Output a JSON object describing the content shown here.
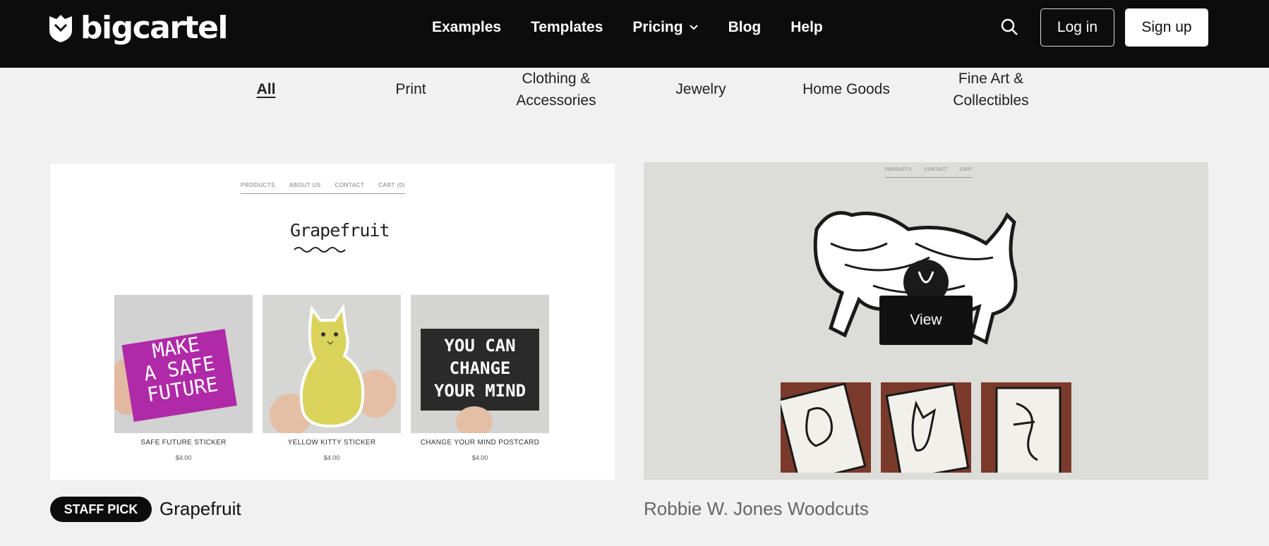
{
  "header": {
    "logo_text": "bigcartel",
    "nav": [
      "Examples",
      "Templates",
      "Pricing",
      "Blog",
      "Help"
    ],
    "login_label": "Log in",
    "signup_label": "Sign up"
  },
  "categories": {
    "all": "All",
    "print": "Print",
    "clothing_line1": "Clothing &",
    "clothing_line2": "Accessories",
    "jewelry": "Jewelry",
    "home_goods": "Home Goods",
    "fineart_line1": "Fine Art &",
    "fineart_line2": "Collectibles"
  },
  "grapefruit_card": {
    "shop_nav": [
      "PRODUCTS",
      "ABOUT US",
      "CONTACT",
      "CART (0)"
    ],
    "shop_logo": "Grapefruit",
    "products": [
      {
        "name": "SAFE FUTURE STICKER",
        "price": "$4.00",
        "art_line1": "MAKE",
        "art_line2": "A SAFE",
        "art_line3": "FUTURE"
      },
      {
        "name": "YELLOW KITTY STICKER",
        "price": "$4.00"
      },
      {
        "name": "CHANGE YOUR MIND POSTCARD",
        "price": "$4.00",
        "art_line1": "YOU CAN",
        "art_line2": "CHANGE",
        "art_line3": "YOUR MIND"
      }
    ],
    "badge": "STAFF PICK",
    "caption": "Grapefruit"
  },
  "robbie_card": {
    "shop_nav": [
      "PRODUCTS",
      "CONTACT",
      "CART"
    ],
    "view_label": "View",
    "caption": "Robbie W. Jones Woodcuts"
  }
}
